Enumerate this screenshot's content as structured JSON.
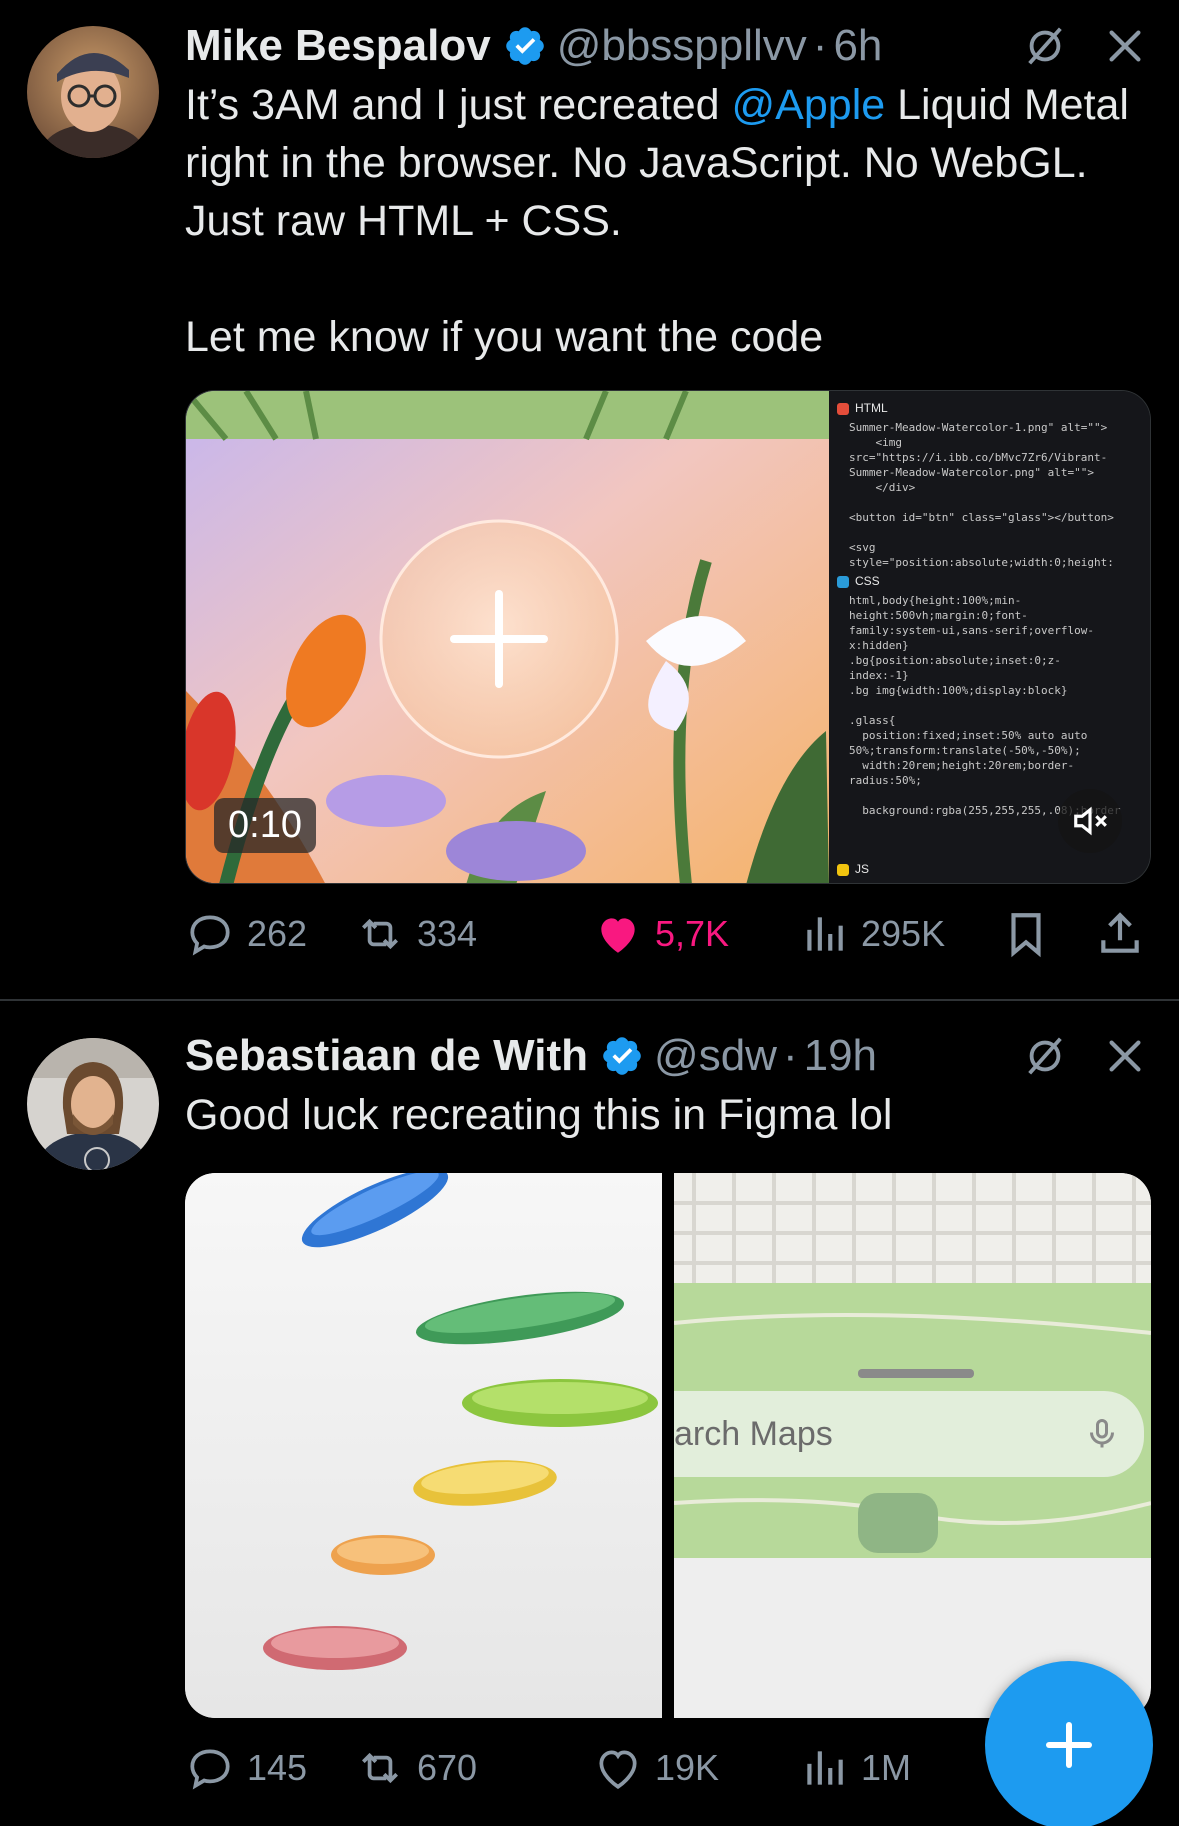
{
  "tweets": [
    {
      "author": {
        "name": "Mike Bespalov",
        "handle": "@bbssppllvv",
        "time": "6h"
      },
      "text": {
        "line1_pre": "It’s 3AM and I just recreated ",
        "mention": "@Apple",
        "line1_post": "  Liquid Metal  right in the browser. No JavaScript. No WebGL. Just raw HTML + CSS.",
        "line2": "Let me know if you want the code"
      },
      "media": {
        "video_time": "0:10",
        "code_sections": {
          "html": "HTML",
          "css": "CSS",
          "js": "JS"
        },
        "html_lines": [
          "Summer-Meadow-Watercolor-1.png\" alt=\"\">",
          "    <img",
          "src=\"https://i.ibb.co/bMvc7Zr6/Vibrant-",
          "Summer-Meadow-Watercolor.png\" alt=\"\">",
          "    </div>",
          "",
          "<button id=\"btn\" class=\"glass\"></button>",
          "",
          "<svg",
          "style=\"position:absolute;width:0;height:"
        ],
        "css_lines": [
          "html,body{height:100%;min-",
          "height:500vh;margin:0;font-",
          "family:system-ui,sans-serif;overflow-",
          "x:hidden}",
          ".bg{position:absolute;inset:0;z-",
          "index:-1}",
          ".bg img{width:100%;display:block}",
          "",
          ".glass{",
          "  position:fixed;inset:50% auto auto",
          "50%;transform:translate(-50%,-50%);",
          "  width:20rem;height:20rem;border-",
          "radius:50%;",
          "",
          "  background:rgba(255,255,255,.08);border"
        ]
      },
      "stats": {
        "replies": "262",
        "retweets": "334",
        "likes": "5,7K",
        "views": "295K"
      }
    },
    {
      "author": {
        "name": "Sebastiaan de With",
        "handle": "@sdw",
        "time": "19h"
      },
      "text": {
        "line1": "Good luck recreating this in Figma lol"
      },
      "media": {
        "search_placeholder": "arch Maps"
      },
      "stats": {
        "replies": "145",
        "retweets": "670",
        "likes": "19K",
        "views": "1M"
      }
    }
  ],
  "colors": {
    "accent": "#1d9bf0",
    "like": "#f91880",
    "muted": "#8b98a5",
    "text": "#e7e9ea",
    "background": "#000000"
  },
  "icons": {
    "verified": "verified-badge-icon",
    "grok": "grok-icon",
    "close": "close-icon",
    "reply": "reply-icon",
    "retweet": "retweet-icon",
    "like": "heart-icon",
    "views": "views-icon",
    "bookmark": "bookmark-icon",
    "share": "share-icon",
    "compose": "plus-icon",
    "mute": "mute-icon",
    "mic": "mic-icon"
  }
}
